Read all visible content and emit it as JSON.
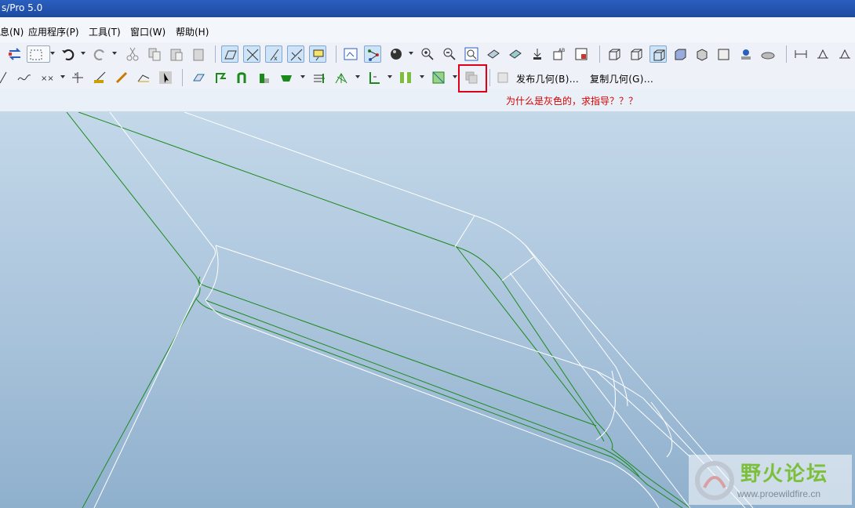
{
  "window": {
    "title": "s/Pro 5.0"
  },
  "menu": {
    "items": [
      {
        "label": "息(N)"
      },
      {
        "label": "应用程序(P)"
      },
      {
        "label": "工具(T)"
      },
      {
        "label": "窗口(W)"
      },
      {
        "label": "帮助(H)"
      }
    ]
  },
  "toolbar2": {
    "publish_geometry": "发布几何(B)...",
    "copy_geometry": "复制几何(G)..."
  },
  "annotation": {
    "note": "为什么是灰色的，求指导？？？",
    "color": "#e0001a"
  },
  "viewport": {
    "background_top": "#c3d8e9",
    "background_bottom": "#8fb0cd",
    "green_edge_color": "#1a8a1a",
    "white_edge_color": "#ffffff"
  },
  "watermark": {
    "title": "野火论坛",
    "url": "www.proewildfire.cn"
  }
}
